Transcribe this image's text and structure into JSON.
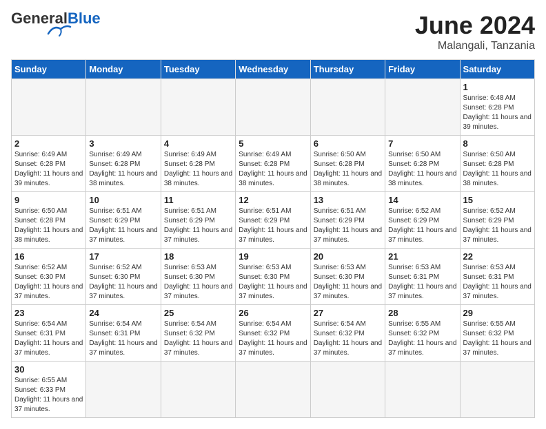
{
  "header": {
    "logo_general": "General",
    "logo_blue": "Blue",
    "title": "June 2024",
    "location": "Malangali, Tanzania"
  },
  "weekdays": [
    "Sunday",
    "Monday",
    "Tuesday",
    "Wednesday",
    "Thursday",
    "Friday",
    "Saturday"
  ],
  "weeks": [
    [
      {
        "day": "",
        "empty": true
      },
      {
        "day": "",
        "empty": true
      },
      {
        "day": "",
        "empty": true
      },
      {
        "day": "",
        "empty": true
      },
      {
        "day": "",
        "empty": true
      },
      {
        "day": "",
        "empty": true
      },
      {
        "day": "1",
        "sunrise": "6:48 AM",
        "sunset": "6:28 PM",
        "daylight": "11 hours and 39 minutes."
      }
    ],
    [
      {
        "day": "2",
        "sunrise": "6:49 AM",
        "sunset": "6:28 PM",
        "daylight": "11 hours and 39 minutes."
      },
      {
        "day": "3",
        "sunrise": "6:49 AM",
        "sunset": "6:28 PM",
        "daylight": "11 hours and 38 minutes."
      },
      {
        "day": "4",
        "sunrise": "6:49 AM",
        "sunset": "6:28 PM",
        "daylight": "11 hours and 38 minutes."
      },
      {
        "day": "5",
        "sunrise": "6:49 AM",
        "sunset": "6:28 PM",
        "daylight": "11 hours and 38 minutes."
      },
      {
        "day": "6",
        "sunrise": "6:50 AM",
        "sunset": "6:28 PM",
        "daylight": "11 hours and 38 minutes."
      },
      {
        "day": "7",
        "sunrise": "6:50 AM",
        "sunset": "6:28 PM",
        "daylight": "11 hours and 38 minutes."
      },
      {
        "day": "8",
        "sunrise": "6:50 AM",
        "sunset": "6:28 PM",
        "daylight": "11 hours and 38 minutes."
      }
    ],
    [
      {
        "day": "9",
        "sunrise": "6:50 AM",
        "sunset": "6:28 PM",
        "daylight": "11 hours and 38 minutes."
      },
      {
        "day": "10",
        "sunrise": "6:51 AM",
        "sunset": "6:29 PM",
        "daylight": "11 hours and 37 minutes."
      },
      {
        "day": "11",
        "sunrise": "6:51 AM",
        "sunset": "6:29 PM",
        "daylight": "11 hours and 37 minutes."
      },
      {
        "day": "12",
        "sunrise": "6:51 AM",
        "sunset": "6:29 PM",
        "daylight": "11 hours and 37 minutes."
      },
      {
        "day": "13",
        "sunrise": "6:51 AM",
        "sunset": "6:29 PM",
        "daylight": "11 hours and 37 minutes."
      },
      {
        "day": "14",
        "sunrise": "6:52 AM",
        "sunset": "6:29 PM",
        "daylight": "11 hours and 37 minutes."
      },
      {
        "day": "15",
        "sunrise": "6:52 AM",
        "sunset": "6:29 PM",
        "daylight": "11 hours and 37 minutes."
      }
    ],
    [
      {
        "day": "16",
        "sunrise": "6:52 AM",
        "sunset": "6:30 PM",
        "daylight": "11 hours and 37 minutes."
      },
      {
        "day": "17",
        "sunrise": "6:52 AM",
        "sunset": "6:30 PM",
        "daylight": "11 hours and 37 minutes."
      },
      {
        "day": "18",
        "sunrise": "6:53 AM",
        "sunset": "6:30 PM",
        "daylight": "11 hours and 37 minutes."
      },
      {
        "day": "19",
        "sunrise": "6:53 AM",
        "sunset": "6:30 PM",
        "daylight": "11 hours and 37 minutes."
      },
      {
        "day": "20",
        "sunrise": "6:53 AM",
        "sunset": "6:30 PM",
        "daylight": "11 hours and 37 minutes."
      },
      {
        "day": "21",
        "sunrise": "6:53 AM",
        "sunset": "6:31 PM",
        "daylight": "11 hours and 37 minutes."
      },
      {
        "day": "22",
        "sunrise": "6:53 AM",
        "sunset": "6:31 PM",
        "daylight": "11 hours and 37 minutes."
      }
    ],
    [
      {
        "day": "23",
        "sunrise": "6:54 AM",
        "sunset": "6:31 PM",
        "daylight": "11 hours and 37 minutes."
      },
      {
        "day": "24",
        "sunrise": "6:54 AM",
        "sunset": "6:31 PM",
        "daylight": "11 hours and 37 minutes."
      },
      {
        "day": "25",
        "sunrise": "6:54 AM",
        "sunset": "6:32 PM",
        "daylight": "11 hours and 37 minutes."
      },
      {
        "day": "26",
        "sunrise": "6:54 AM",
        "sunset": "6:32 PM",
        "daylight": "11 hours and 37 minutes."
      },
      {
        "day": "27",
        "sunrise": "6:54 AM",
        "sunset": "6:32 PM",
        "daylight": "11 hours and 37 minutes."
      },
      {
        "day": "28",
        "sunrise": "6:55 AM",
        "sunset": "6:32 PM",
        "daylight": "11 hours and 37 minutes."
      },
      {
        "day": "29",
        "sunrise": "6:55 AM",
        "sunset": "6:32 PM",
        "daylight": "11 hours and 37 minutes."
      }
    ],
    [
      {
        "day": "30",
        "sunrise": "6:55 AM",
        "sunset": "6:33 PM",
        "daylight": "11 hours and 37 minutes."
      },
      {
        "day": "",
        "empty": true
      },
      {
        "day": "",
        "empty": true
      },
      {
        "day": "",
        "empty": true
      },
      {
        "day": "",
        "empty": true
      },
      {
        "day": "",
        "empty": true
      },
      {
        "day": "",
        "empty": true
      }
    ]
  ],
  "labels": {
    "sunrise": "Sunrise:",
    "sunset": "Sunset:",
    "daylight": "Daylight:"
  }
}
